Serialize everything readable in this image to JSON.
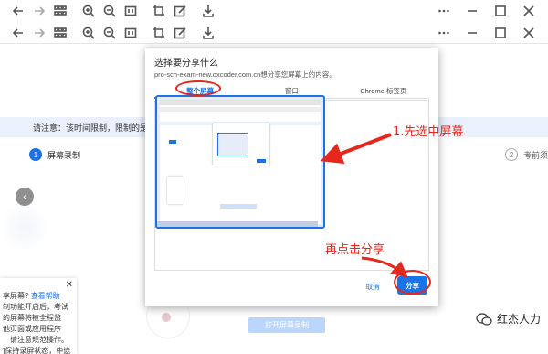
{
  "toolbar": {
    "icons": [
      "back-icon",
      "forward-icon",
      "grid-icon",
      "zoom-in-icon",
      "zoom-out-icon",
      "fit-icon",
      "crop-icon",
      "edit-icon",
      "download-icon"
    ],
    "right_icons": [
      "more-icon",
      "minimize-icon",
      "maximize-icon",
      "close-icon"
    ]
  },
  "background_page": {
    "notice": "请注意：该时间限制，限制的是开始答",
    "step1_num": "1",
    "step1_label": "屏幕录制",
    "step2_num": "2",
    "step2_label": "考前须",
    "help_panel": {
      "line1_prefix": "享屏幕?",
      "line1_link": "查看帮助",
      "line2": "制功能开启后，考试",
      "line3": "的屏幕将被全程监",
      "line4": "他页面或应用程序",
      "line5": "请注意规范操作。",
      "line6": "]保持录屏状态，中途"
    },
    "open_button": "打开屏幕录制"
  },
  "dialog": {
    "title": "选择要分享什么",
    "subtitle": "pro-sch-exam-new.oxcoder.com.cn想分享您屏幕上的内容。",
    "tabs": [
      {
        "label": "整个屏幕",
        "active": true
      },
      {
        "label": "窗口",
        "active": false
      },
      {
        "label": "Chrome 标签页",
        "active": false
      }
    ],
    "cancel_label": "取消",
    "share_label": "分享"
  },
  "annotations": {
    "step1": "1.先选中屏幕",
    "step2": "再点击分享",
    "color": "#e4281e"
  },
  "watermark": "红杰人力",
  "colors": {
    "accent": "#1a73e8",
    "notice_bg": "#eaf1fc"
  }
}
